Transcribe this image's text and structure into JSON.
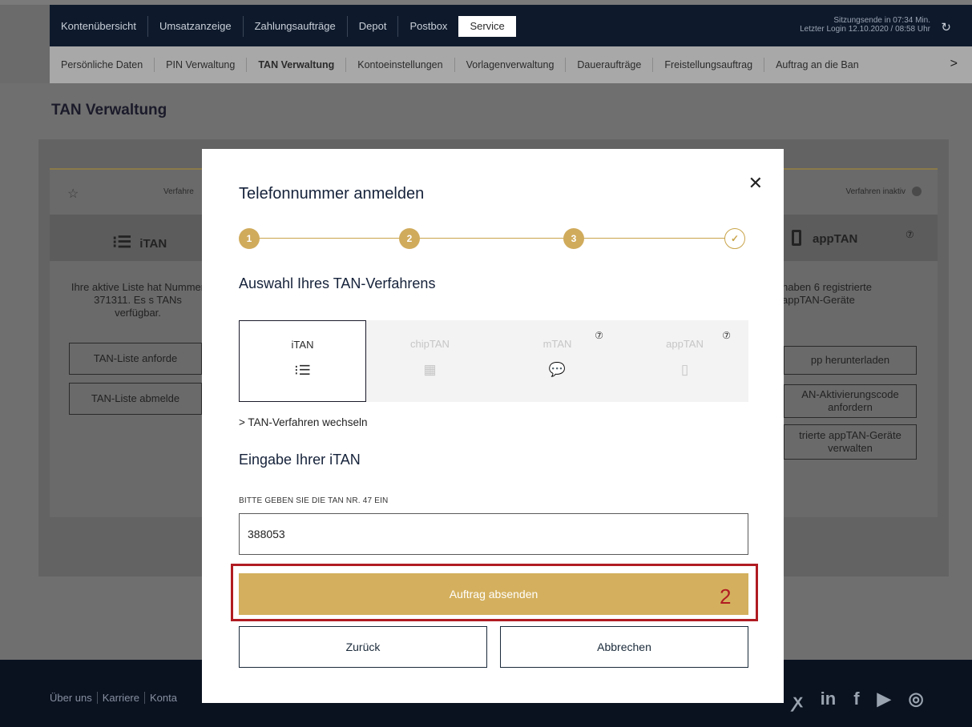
{
  "nav": {
    "items": [
      "Kontenübersicht",
      "Umsatzanzeige",
      "Zahlungsaufträge",
      "Depot",
      "Postbox",
      "Service"
    ],
    "active": "Service",
    "session_line1": "Sitzungsende in 07:34 Min.",
    "session_line2": "Letzter Login 12.10.2020 / 08:58 Uhr"
  },
  "subnav": {
    "items": [
      "Persönliche Daten",
      "PIN Verwaltung",
      "TAN Verwaltung",
      "Kontoeinstellungen",
      "Vorlagenverwaltung",
      "Daueraufträge",
      "Freistellungsauftrag",
      "Auftrag an die Ban"
    ],
    "active": "TAN Verwaltung"
  },
  "page": {
    "title": "TAN Verwaltung",
    "card_left_status": "Verfahre",
    "card_right_status": "Verfahren inaktiv",
    "left_method": "iTAN",
    "right_method": "appTAN",
    "left_text": "Ihre aktive Liste hat Nummer 371311. Es s TANs verfügbar.",
    "right_text": "haben 6 registrierte appTAN-Geräte",
    "left_btn1": "TAN-Liste anforde",
    "left_btn2": "TAN-Liste abmelde",
    "right_btn1": "pp herunterladen",
    "right_btn2": "AN-Aktivierungscode anfordern",
    "right_btn3": "trierte appTAN-Geräte verwalten"
  },
  "modal": {
    "title": "Telefonnummer anmelden",
    "steps": [
      "1",
      "2",
      "3",
      "✓"
    ],
    "section1": "Auswahl Ihres TAN-Verfahrens",
    "methods": [
      {
        "label": "iTAN",
        "icon": "list-numbered-icon",
        "glyph": "⁝☰",
        "active": true,
        "help": ""
      },
      {
        "label": "chipTAN",
        "icon": "calculator-icon",
        "glyph": "▦",
        "active": false,
        "help": ""
      },
      {
        "label": "mTAN",
        "icon": "sms-icon",
        "glyph": "💬",
        "active": false,
        "help": "⑦"
      },
      {
        "label": "appTAN",
        "icon": "smartphone-icon",
        "glyph": "▯",
        "active": false,
        "help": "⑦"
      }
    ],
    "change_link": "> TAN-Verfahren wechseln",
    "section2": "Eingabe Ihrer iTAN",
    "field_label": "BITTE GEBEN SIE DIE TAN NR. 47 EIN",
    "tan_value": "388053",
    "submit": "Auftrag absenden",
    "back": "Zurück",
    "cancel": "Abbrechen"
  },
  "footer": {
    "links": [
      "Über uns",
      "Karriere",
      "Konta"
    ]
  },
  "annotation": {
    "number": "2",
    "color": "#b01c22"
  },
  "colors": {
    "gold": "#d4b05e",
    "navy": "#0e1a2c"
  }
}
